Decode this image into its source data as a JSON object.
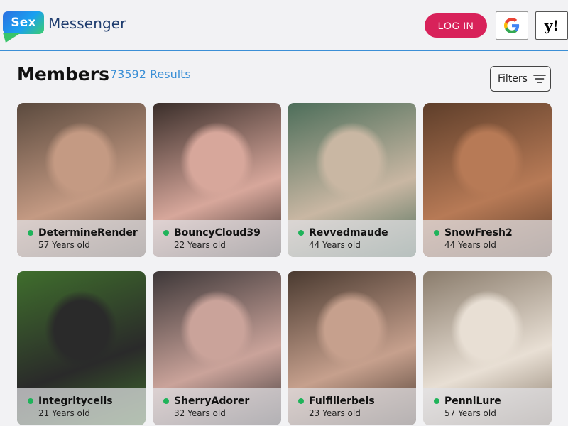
{
  "header": {
    "logo_badge": "Sex",
    "logo_text": "Messenger",
    "login_label": "LOG IN",
    "google_icon": "google-icon",
    "yahoo_label": "y!"
  },
  "main": {
    "title": "Members",
    "results": "73592 Results",
    "filters_label": "Filters"
  },
  "members": [
    {
      "name": "DetermineRender",
      "age": "57 Years old",
      "online": true,
      "colors": [
        "#5b4a3e",
        "#c49a83"
      ]
    },
    {
      "name": "BouncyCloud39",
      "age": "22 Years old",
      "online": true,
      "colors": [
        "#3a2e2a",
        "#d7a79b"
      ]
    },
    {
      "name": "Revvedmaude",
      "age": "44 Years old",
      "online": true,
      "colors": [
        "#4d6e5a",
        "#c9b7a3"
      ]
    },
    {
      "name": "SnowFresh2",
      "age": "44 Years old",
      "online": true,
      "colors": [
        "#5e3e2a",
        "#b77a56"
      ]
    },
    {
      "name": "Integritycells",
      "age": "21 Years old",
      "online": true,
      "colors": [
        "#3f6e2c",
        "#2a2a2a"
      ]
    },
    {
      "name": "SherryAdorer",
      "age": "32 Years old",
      "online": true,
      "colors": [
        "#3d3738",
        "#caa39a"
      ]
    },
    {
      "name": "Fulfillerbels",
      "age": "23 Years old",
      "online": true,
      "colors": [
        "#4a3a30",
        "#c6a08d"
      ]
    },
    {
      "name": "PenniLure",
      "age": "57 Years old",
      "online": true,
      "colors": [
        "#8a7c6c",
        "#e8dfd4"
      ]
    }
  ]
}
